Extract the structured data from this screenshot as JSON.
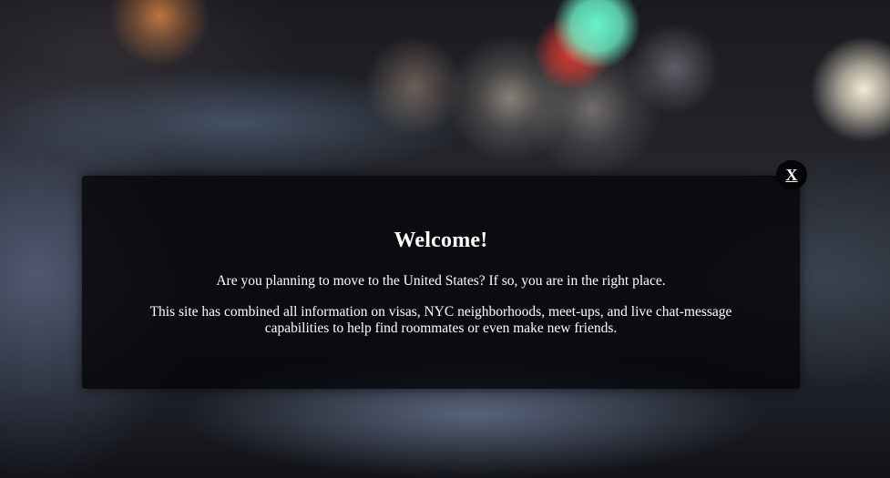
{
  "modal": {
    "close_label": "X",
    "title": "Welcome!",
    "paragraph1": "Are you planning to move to the United States? If so, you are in the right place.",
    "paragraph2": "This site has combined all information on visas, NYC neighborhoods, meet-ups, and live chat-message capabilities to help find roommates or even make new friends."
  },
  "colors": {
    "overlay": "#050508",
    "text": "#ffffff"
  }
}
